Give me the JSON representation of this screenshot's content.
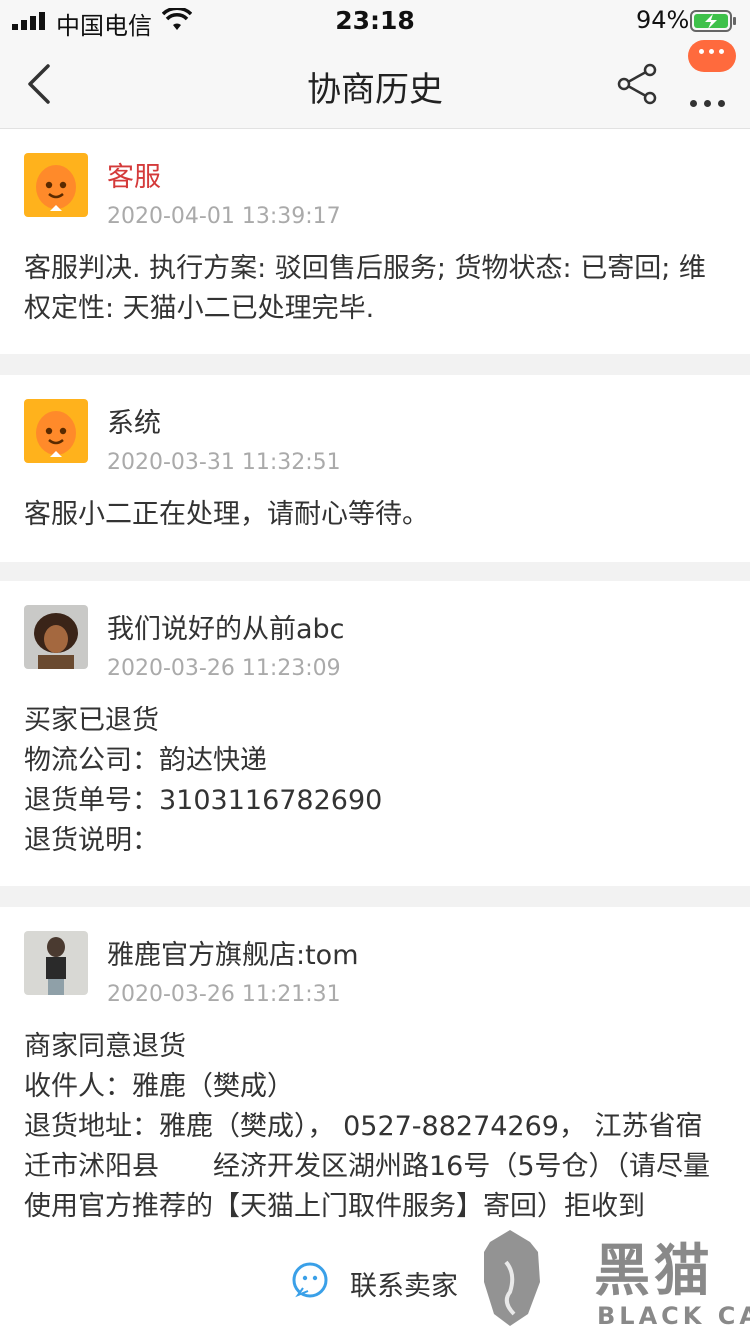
{
  "status_bar": {
    "carrier": "中国电信",
    "time": "23:18",
    "battery_percent": "94%"
  },
  "navbar": {
    "title": "协商历史"
  },
  "records": [
    {
      "name": "客服",
      "date": "2020-04-01 13:39:17",
      "body": [
        "客服判决. 执行方案: 驳回售后服务; 货物状态: 已寄回; 维权定性: 天猫小二已处理完毕."
      ]
    },
    {
      "name": "系统",
      "date": "2020-03-31 11:32:51",
      "body": [
        "客服小二正在处理，请耐心等待。"
      ]
    },
    {
      "name": "我们说好的从前abc",
      "date": "2020-03-26 11:23:09",
      "body": [
        "买家已退货",
        "物流公司：韵达快递",
        "退货单号：3103116782690",
        "退货说明："
      ]
    },
    {
      "name": "雅鹿官方旗舰店:tom",
      "date": "2020-03-26 11:21:31",
      "body": [
        "商家同意退货",
        "收件人：雅鹿（樊成）",
        "退货地址：雅鹿（樊成）， 0527-88274269， 江苏省宿迁市沭阳县　　经济开发区湖州路16号（5号仓）（请尽量使用官方推荐的【天猫上门取件服务】寄回）拒收到"
      ]
    }
  ],
  "bottom_bar": {
    "contact_label": "联系卖家"
  },
  "watermark": {
    "title": "黑猫",
    "subtitle": "BLACK CAT"
  },
  "colors": {
    "customer_service_name": "#d43a3a",
    "accent_orange": "#ff6a3d",
    "contact_icon": "#3aa0e8"
  }
}
